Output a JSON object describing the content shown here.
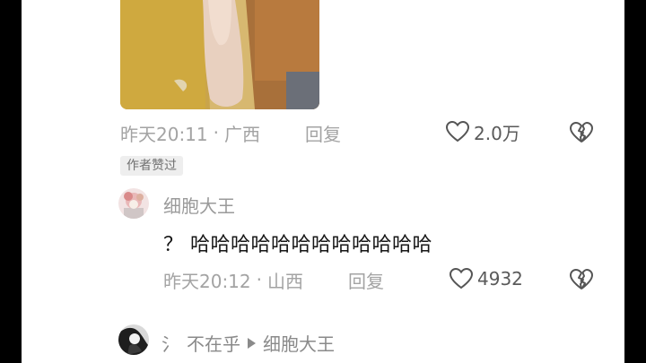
{
  "comment": {
    "image_alt": "fabric photo",
    "timestamp": "昨天20:11",
    "location": "广西",
    "reply_label": "回复",
    "likes": "2.0万",
    "author_liked_badge": "作者赞过"
  },
  "reply": {
    "username": "细胞大王",
    "text": "？ 哈哈哈哈哈哈哈哈哈哈哈哈",
    "timestamp": "昨天20:12",
    "location": "山西",
    "reply_label": "回复",
    "likes": "4932"
  },
  "next_reply": {
    "username_prefix": "氵",
    "username": "不在乎",
    "reply_to": "细胞大王"
  },
  "separator": "·",
  "colors": {
    "background": "#ffffff",
    "meta_text": "#a3a3a3",
    "primary_text": "#161616"
  }
}
